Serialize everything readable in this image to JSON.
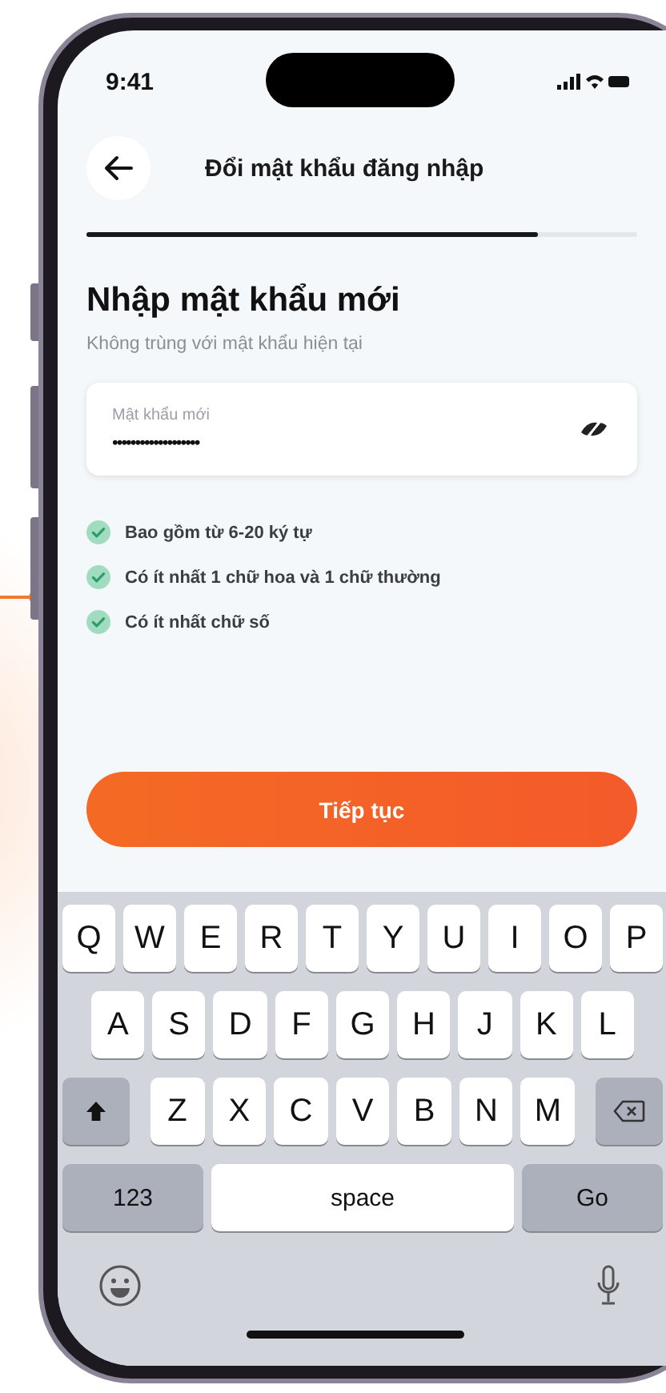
{
  "status_bar": {
    "time": "9:41"
  },
  "header": {
    "title": "Đổi mật khẩu đăng nhập"
  },
  "progress": {
    "level": 0.82
  },
  "heading": "Nhập mật khẩu mới",
  "subheading": "Không trùng với mật khẩu hiện tại",
  "password_field": {
    "label": "Mật khẩu mới",
    "value": "•••••••••••••••••••"
  },
  "requirements": [
    {
      "text": "Bao gồm từ 6-20 ký tự",
      "met": true
    },
    {
      "text": "Có ít nhất 1 chữ hoa và 1 chữ thường",
      "met": true
    },
    {
      "text": "Có ít nhất chữ số",
      "met": true
    }
  ],
  "continue_button": "Tiếp tục",
  "keyboard": {
    "rows": [
      [
        "Q",
        "W",
        "E",
        "R",
        "T",
        "Y",
        "U",
        "I",
        "O",
        "P"
      ],
      [
        "A",
        "S",
        "D",
        "F",
        "G",
        "H",
        "J",
        "K",
        "L"
      ],
      [
        "Z",
        "X",
        "C",
        "V",
        "B",
        "N",
        "M"
      ]
    ],
    "numbers_key": "123",
    "space_key": "space",
    "go_key": "Go"
  }
}
